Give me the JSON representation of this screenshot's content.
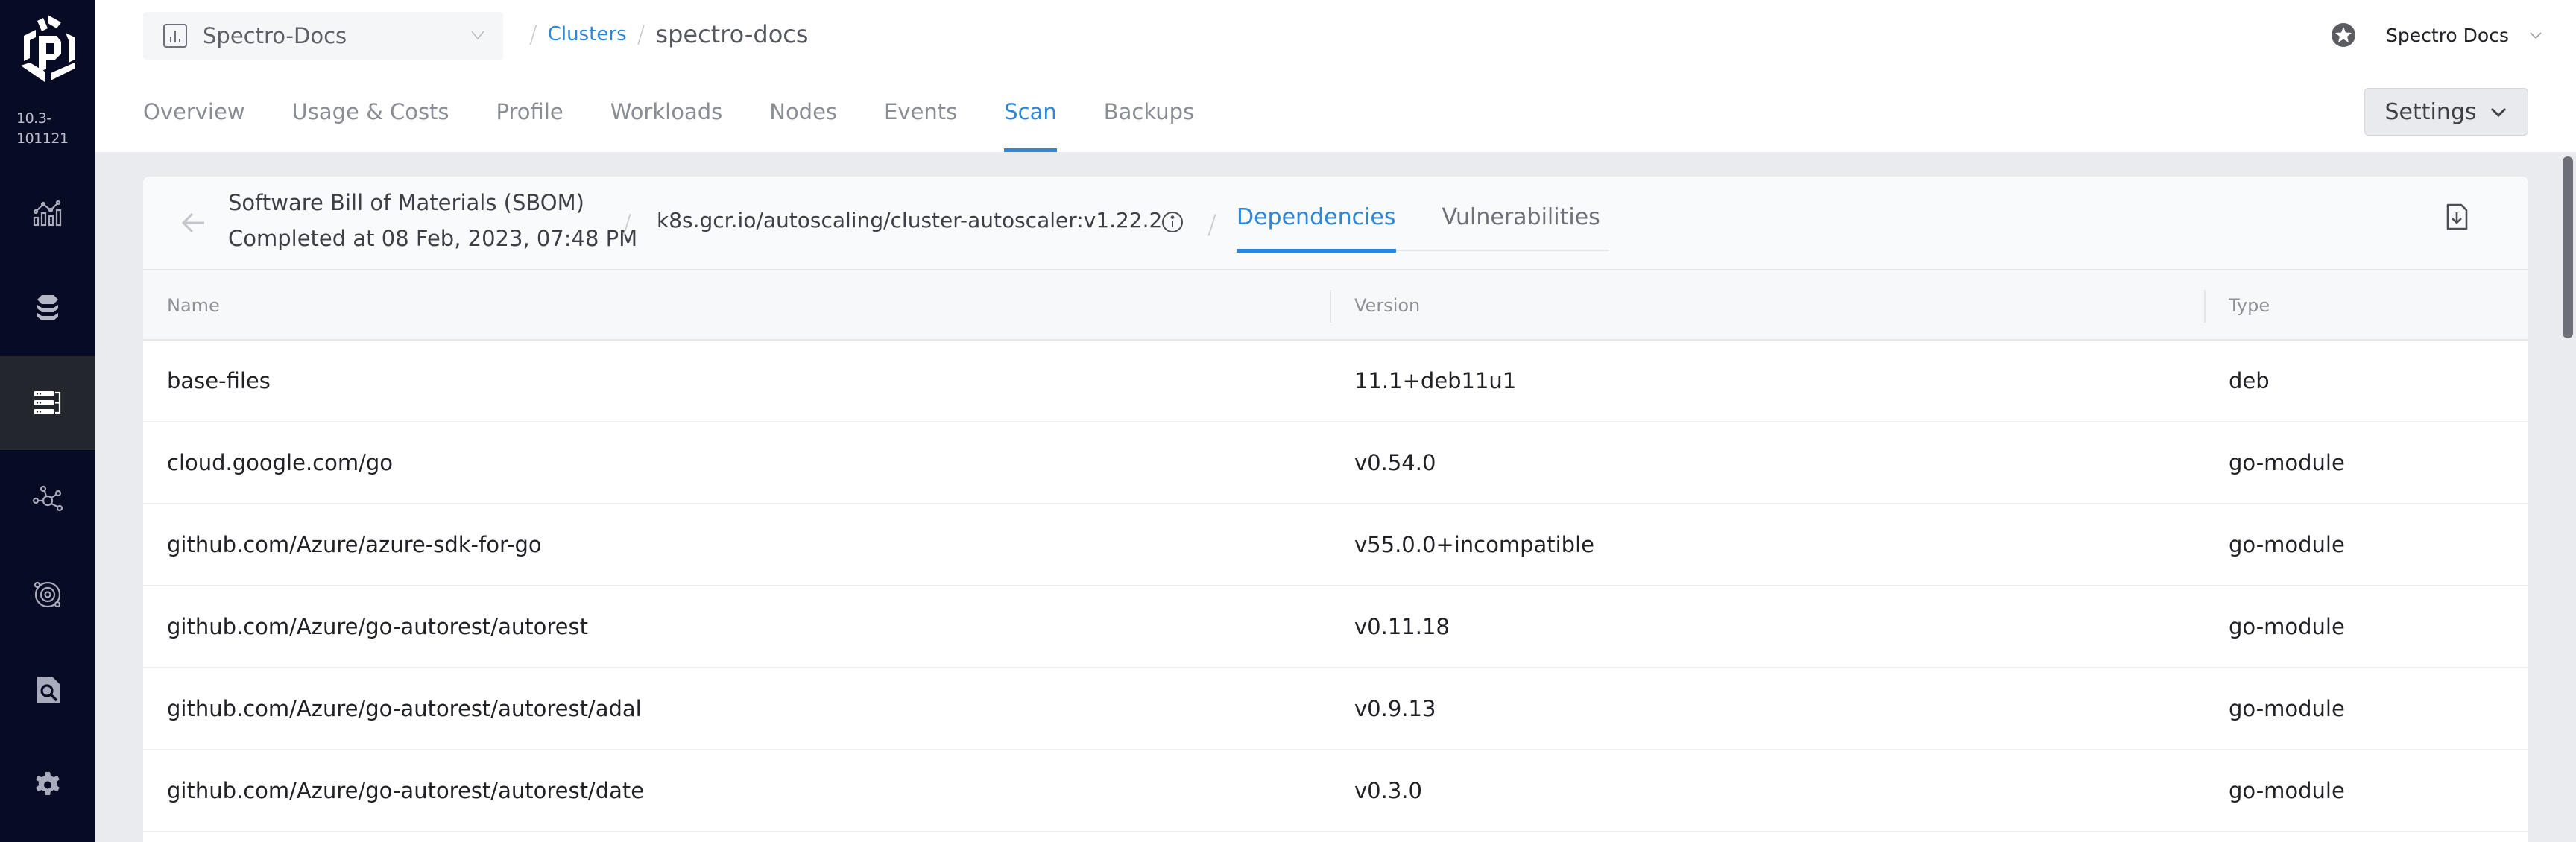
{
  "sidebar": {
    "version_line1": "10.3-",
    "version_line2": "101121",
    "items": [
      {
        "icon": "chart-icon",
        "label": "Dashboard",
        "active": false
      },
      {
        "icon": "database-icon",
        "label": "Projects",
        "active": false
      },
      {
        "icon": "server-list-icon",
        "label": "Clusters",
        "active": true
      },
      {
        "icon": "network-icon",
        "label": "Network",
        "active": false
      },
      {
        "icon": "orbit-icon",
        "label": "Workspaces",
        "active": false
      },
      {
        "icon": "file-search-icon",
        "label": "Audit Logs",
        "active": false
      },
      {
        "icon": "gear-icon",
        "label": "Settings",
        "active": false
      }
    ]
  },
  "header": {
    "project": "Spectro-Docs",
    "breadcrumb": {
      "link": "Clusters",
      "current": "spectro-docs"
    },
    "user": "Spectro Docs",
    "tabs": [
      {
        "label": "Overview",
        "active": false
      },
      {
        "label": "Usage & Costs",
        "active": false
      },
      {
        "label": "Profile",
        "active": false
      },
      {
        "label": "Workloads",
        "active": false
      },
      {
        "label": "Nodes",
        "active": false
      },
      {
        "label": "Events",
        "active": false
      },
      {
        "label": "Scan",
        "active": true
      },
      {
        "label": "Backups",
        "active": false
      }
    ],
    "settings_label": "Settings"
  },
  "scan": {
    "title": "Software Bill of Materials (SBOM)",
    "completed": "Completed at 08 Feb, 2023, 07:48 PM",
    "image": "k8s.gcr.io/autoscaling/cluster-autoscaler:v1.22.2",
    "subtabs": [
      {
        "label": "Dependencies",
        "active": true
      },
      {
        "label": "Vulnerabilities",
        "active": false
      }
    ]
  },
  "table": {
    "columns": [
      "Name",
      "Version",
      "Type"
    ],
    "rows": [
      {
        "name": "base-files",
        "version": "11.1+deb11u1",
        "type": "deb"
      },
      {
        "name": "cloud.google.com/go",
        "version": "v0.54.0",
        "type": "go-module"
      },
      {
        "name": "github.com/Azure/azure-sdk-for-go",
        "version": "v55.0.0+incompatible",
        "type": "go-module"
      },
      {
        "name": "github.com/Azure/go-autorest/autorest",
        "version": "v0.11.18",
        "type": "go-module"
      },
      {
        "name": "github.com/Azure/go-autorest/autorest/adal",
        "version": "v0.9.13",
        "type": "go-module"
      },
      {
        "name": "github.com/Azure/go-autorest/autorest/date",
        "version": "v0.3.0",
        "type": "go-module"
      }
    ]
  },
  "colors": {
    "accent": "#2f86d6",
    "sidebar_bg": "#070b24",
    "sidebar_active": "#23262d",
    "page_bg": "#eaebee"
  }
}
